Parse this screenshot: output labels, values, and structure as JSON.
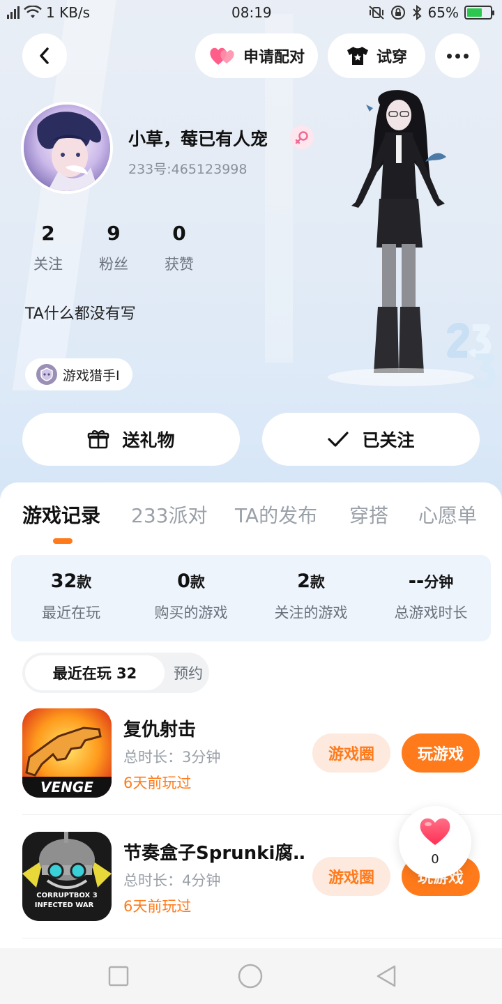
{
  "status_bar": {
    "signal": "signal-icon",
    "wifi": "wifi-icon",
    "speed": "1 KB/s",
    "time": "08:19",
    "battery_percent": "65%",
    "battery_level": 0.65
  },
  "top_nav": {
    "match_label": "申请配对",
    "try_on_label": "试穿"
  },
  "profile": {
    "name": "小草，莓已有人宠",
    "gender_symbol": "♀",
    "id_text": "233号:465123998",
    "stats": [
      {
        "value": "2",
        "label": "关注"
      },
      {
        "value": "9",
        "label": "粉丝"
      },
      {
        "value": "0",
        "label": "获赞"
      }
    ],
    "bio": "TA什么都没有写",
    "badge": "游戏猎手I",
    "gift_label": "送礼物",
    "follow_label": "已关注"
  },
  "tabs": [
    "游戏记录",
    "233派对",
    "TA的发布",
    "穿搭",
    "心愿单"
  ],
  "active_tab": 0,
  "summary": [
    {
      "value": "32",
      "unit": "款",
      "label": "最近在玩"
    },
    {
      "value": "0",
      "unit": "款",
      "label": "购买的游戏"
    },
    {
      "value": "2",
      "unit": "款",
      "label": "关注的游戏"
    },
    {
      "value": "--",
      "unit": "分钟",
      "label": "总游戏时长"
    }
  ],
  "segment": {
    "active": "最近在玩 32",
    "inactive": "预约"
  },
  "games": [
    {
      "title": "复仇射击",
      "duration": "总时长：3分钟",
      "last_played": "6天前玩过",
      "circle_label": "游戏圈",
      "play_label": "玩游戏",
      "icon_text": "VENGE"
    },
    {
      "title": "节奏盒子Sprunki腐…",
      "duration": "总时长：4分钟",
      "last_played": "6天前玩过",
      "circle_label": "游戏圈",
      "play_label": "玩游戏",
      "icon_text": "CORRUPTBOX 3 INFECTED WAR"
    }
  ],
  "like_button": {
    "count": "0"
  },
  "colors": {
    "accent": "#ff7a1a",
    "accent_soft": "#fde9de",
    "card_bg": "#eef4fc",
    "heart": "#ff4d6a"
  }
}
